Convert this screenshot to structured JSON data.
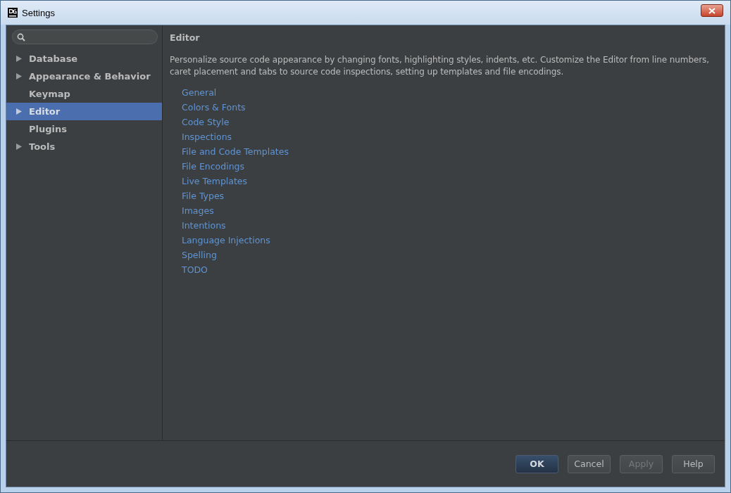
{
  "window": {
    "title": "Settings"
  },
  "sidebar": {
    "items": [
      {
        "label": "Database",
        "kind": "group",
        "selected": false
      },
      {
        "label": "Appearance & Behavior",
        "kind": "group",
        "selected": false
      },
      {
        "label": "Keymap",
        "kind": "leaf",
        "selected": false
      },
      {
        "label": "Editor",
        "kind": "group",
        "selected": true
      },
      {
        "label": "Plugins",
        "kind": "leaf",
        "selected": false
      },
      {
        "label": "Tools",
        "kind": "group",
        "selected": false
      }
    ]
  },
  "content": {
    "title": "Editor",
    "description": "Personalize source code appearance by changing fonts, highlighting styles, indents, etc. Customize the Editor from line numbers, caret placement and tabs to source code inspections, setting up templates and file encodings.",
    "links": [
      "General",
      "Colors & Fonts",
      "Code Style",
      "Inspections",
      "File and Code Templates",
      "File Encodings",
      "Live Templates",
      "File Types",
      "Images",
      "Intentions",
      "Language Injections",
      "Spelling",
      "TODO"
    ]
  },
  "buttons": [
    {
      "label": "OK",
      "kind": "default",
      "disabled": false
    },
    {
      "label": "Cancel",
      "kind": "normal",
      "disabled": false
    },
    {
      "label": "Apply",
      "kind": "normal",
      "disabled": true
    },
    {
      "label": "Help",
      "kind": "normal",
      "disabled": false
    }
  ]
}
